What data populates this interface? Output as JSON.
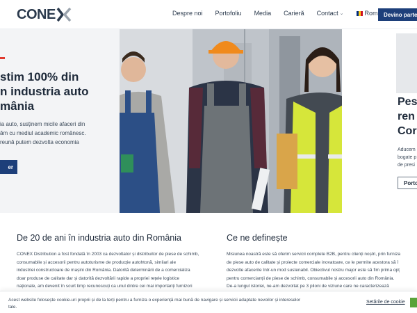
{
  "header": {
    "logo_text": "CONE",
    "nav": [
      {
        "label": "Despre noi"
      },
      {
        "label": "Portofoliu"
      },
      {
        "label": "Media"
      },
      {
        "label": "Carieră"
      },
      {
        "label": "Contact"
      },
      {
        "label": "Română"
      }
    ],
    "cta_label": "Devino partener"
  },
  "hero": {
    "title_lines": [
      "stim 100% din",
      "n industria auto",
      "mânia"
    ],
    "text_lines": [
      "ia auto, susținem micile afaceri din",
      "ăm cu mediul academic românesc.",
      "reună putem dezvolta economia"
    ],
    "button_label": "er"
  },
  "hero_right": {
    "title_lines": [
      "Pes",
      "ren",
      "Cor"
    ],
    "text_lines": [
      "Aducem",
      "bogate p",
      "de presi"
    ],
    "button_label": "Portof"
  },
  "sections": {
    "left_title": "De 20 de ani în industria auto din România",
    "left_text": [
      "CONEX Distribution a fost fondată în 2003 ca dezvoltator și distribuitor de piese de schimb,",
      "consumabile și accesorii pentru autoturisme de producție autohtonă, similari ale",
      "industriei constructoare de mașini din România. Datorită determinării de a comercializa",
      "doar produse de calitate dar și datorită dezvoltării rapide a propriei rețele logistice",
      "naționale, am devenit în scurt timp recunoscuți ca unul dintre cei mai importanți furnizori"
    ],
    "right_title": "Ce ne definește",
    "right_text": [
      "Misiunea noastră este să oferim servicii complete B2B, pentru clienți noștri, prin furniza",
      "de piese auto de calitate și proiecte comerciale inovatoare, ce le permite acestora să î",
      "dezvolte afacerile într-un mod sustenabil. Obiectivul nostru major este să fim prima opț",
      "pentru comercianții de piese de schimb, consumabile și accesorii auto din România.",
      "De-a lungul istoriei, ne-am dezvoltat pe 3 piloni de viziune care ne caracterizează"
    ]
  },
  "cookie": {
    "text": "Acest website folosește cookie-uri proprii și de la terți pentru a furniza o experiență mai bună de navigare și servicii adaptate nevoilor și intereselor tale.",
    "settings_label": "Setările de cookie"
  },
  "colors": {
    "primary": "#1d3f7a",
    "accent_red": "#e03a2f",
    "cookie_accept": "#5aa33a",
    "text": "#1e2a3a"
  }
}
